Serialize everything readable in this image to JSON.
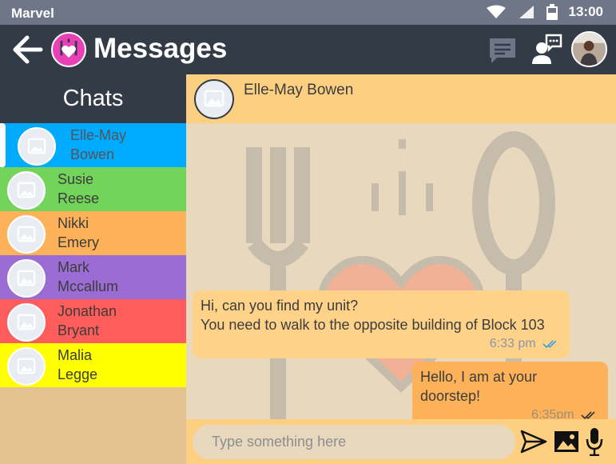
{
  "status_bar": {
    "carrier": "Marvel",
    "time": "13:00"
  },
  "app_bar": {
    "title": "Messages"
  },
  "sidebar": {
    "title": "Chats",
    "contacts": [
      {
        "name": "Elle-May Bowen",
        "line1": "Elle-May",
        "line2": "Bowen",
        "color": "#00aaff",
        "active": true
      },
      {
        "name": "Susie Reese",
        "line1": "Susie",
        "line2": "Reese",
        "color": "#72d45a"
      },
      {
        "name": "Nikki Emery",
        "line1": "Nikki",
        "line2": "Emery",
        "color": "#fdb25a"
      },
      {
        "name": "Mark Mccallum",
        "line1": "Mark",
        "line2": "Mccallum",
        "color": "#9a6cd4"
      },
      {
        "name": "Jonathan Bryant",
        "line1": "Jonathan",
        "line2": "Bryant",
        "color": "#ff5c5c"
      },
      {
        "name": "Malia Legge",
        "line1": "Malia",
        "line2": "Legge",
        "color": "#ffff00"
      }
    ]
  },
  "chat": {
    "contact_name": "Elle-May Bowen",
    "messages": [
      {
        "direction": "in",
        "line1": "Hi, can you find my unit?",
        "line2": "You need to walk to the opposite building of Block 103",
        "time": "6:33 pm"
      },
      {
        "direction": "out",
        "line1": "Hello, I am at your doorstep!",
        "time": "6:35pm"
      }
    ],
    "composer": {
      "placeholder": "Type something here"
    }
  },
  "colors": {
    "app_bar": "#333b47",
    "status_bar": "#6e7688",
    "chat_header": "#fdd081",
    "chat_background": "#e8d8be",
    "incoming_bubble": "#ffd289",
    "outgoing_bubble": "#fdb25a",
    "read_tick": "#3aa0e0"
  },
  "icons": [
    "wifi-icon",
    "signal-icon",
    "battery-icon",
    "back-arrow-icon",
    "app-logo-icon",
    "chat-icon",
    "support-icon",
    "avatar-placeholder-icon",
    "double-tick-icon",
    "send-icon",
    "image-icon",
    "microphone-icon"
  ]
}
